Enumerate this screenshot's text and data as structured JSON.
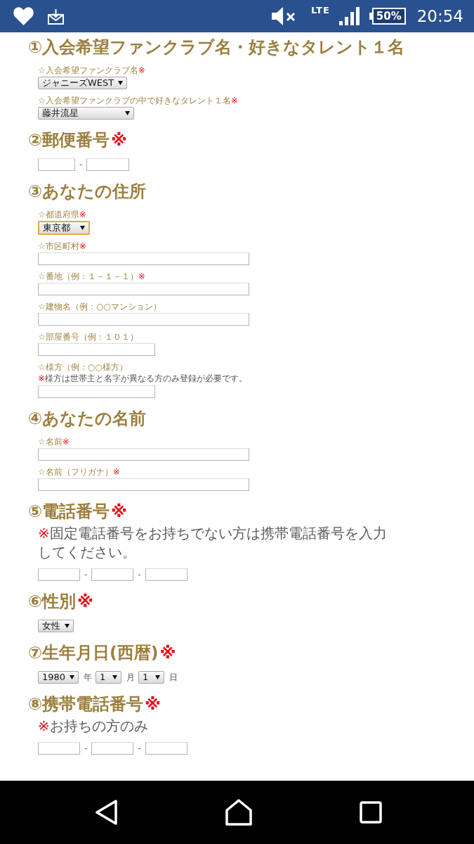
{
  "status_bar": {
    "network": "LTE",
    "battery": "50%",
    "time": "20:54"
  },
  "sections": [
    {
      "title": "①入会希望ファンクラブ名・好きなタレント１名",
      "fields": [
        {
          "kind": "select",
          "label": "☆入会希望ファンクラブ名",
          "required_mark": "※",
          "value": "ジャニーズWEST",
          "focused": false
        },
        {
          "kind": "select",
          "label": "☆入会希望ファンクラブの中で好きなタレント１名",
          "required_mark": "※",
          "value": "藤井流星",
          "focused": false
        }
      ]
    },
    {
      "title": "②郵便番号",
      "required_mark": "※",
      "fields": [
        {
          "kind": "group",
          "parts": [
            {
              "kind": "input"
            },
            {
              "kind": "separator",
              "text": "-"
            },
            {
              "kind": "input"
            }
          ]
        }
      ]
    },
    {
      "title": "③あなたの住所",
      "fields": [
        {
          "kind": "select",
          "label": "☆都道府県",
          "required_mark": "※",
          "value": "東京都",
          "focused": true
        },
        {
          "kind": "input",
          "label": "☆市区町村",
          "required_mark": "※"
        },
        {
          "kind": "input",
          "label": "☆番地（例：１－１－１）",
          "required_mark": "※"
        },
        {
          "kind": "input",
          "label": "☆建物名（例：○○マンション）"
        },
        {
          "kind": "short_input",
          "label": "☆部屋番号（例：１０１）"
        },
        {
          "kind": "short_input",
          "label": "☆様方（例：○○様方）",
          "note": {
            "mark": "※",
            "text": "様方は世帯主と名字が異なる方のみ登録が必要です。"
          }
        }
      ]
    },
    {
      "title": "④あなたの名前",
      "fields": [
        {
          "kind": "input",
          "label": "☆名前",
          "required_mark": "※"
        },
        {
          "kind": "input",
          "label": "☆名前（フリガナ）",
          "required_mark": "※"
        }
      ]
    },
    {
      "title": "⑤電話番号",
      "required_mark": "※",
      "note": {
        "mark": "※",
        "text": "固定電話番号をお持ちでない方は携帯電話番号を入力してください。"
      },
      "fields": [
        {
          "kind": "group",
          "parts": [
            {
              "kind": "input"
            },
            {
              "kind": "separator",
              "text": "-"
            },
            {
              "kind": "input"
            },
            {
              "kind": "separator",
              "text": "-"
            },
            {
              "kind": "input"
            }
          ]
        }
      ]
    },
    {
      "title": "⑥性別",
      "required_mark": "※",
      "fields": [
        {
          "kind": "select",
          "value": "女性",
          "focused": false
        }
      ]
    },
    {
      "title": "⑦生年月日(西暦)",
      "required_mark": "※",
      "fields": [
        {
          "kind": "group",
          "parts": [
            {
              "kind": "select",
              "value": "1980",
              "focused": false
            },
            {
              "kind": "unit",
              "text": "年"
            },
            {
              "kind": "select",
              "value": "1",
              "focused": false
            },
            {
              "kind": "unit",
              "text": "月"
            },
            {
              "kind": "select",
              "value": "1",
              "focused": false
            },
            {
              "kind": "unit",
              "text": "日"
            }
          ]
        }
      ]
    },
    {
      "title": "⑧携帯電話番号",
      "required_mark": "※",
      "note": {
        "mark": "※",
        "text": "お持ちの方のみ"
      },
      "fields": [
        {
          "kind": "group",
          "parts": [
            {
              "kind": "input"
            },
            {
              "kind": "separator",
              "text": "-"
            },
            {
              "kind": "input"
            },
            {
              "kind": "separator",
              "text": "-"
            },
            {
              "kind": "input"
            }
          ]
        }
      ]
    }
  ]
}
